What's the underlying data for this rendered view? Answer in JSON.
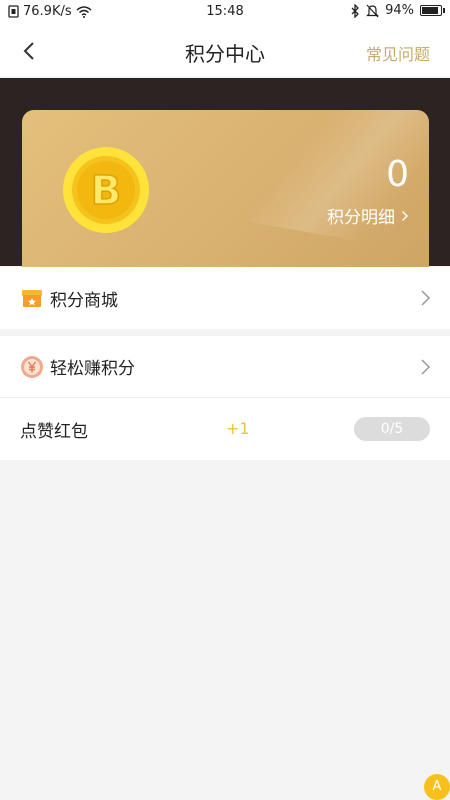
{
  "status_bar": {
    "net_speed": "76.9K/s",
    "time": "15:48",
    "battery": "94%",
    "battery_level": 0.94
  },
  "header": {
    "title": "积分中心",
    "faq_label": "常见问题"
  },
  "points_card": {
    "coin_letter": "B",
    "points": "0",
    "detail_label": "积分明细"
  },
  "menu": {
    "mall_label": "积分商城",
    "earn_label": "轻松赚积分"
  },
  "task": {
    "name": "点赞红包",
    "reward": "+1",
    "progress": "0/5",
    "done": 0,
    "total": 5
  },
  "floating": {
    "badge_label": "A"
  },
  "colors": {
    "accent_gold": "#c7a96c",
    "card_gold": "#d9b170",
    "hero_dark": "#2c2422",
    "reward_yellow": "#f1c040"
  }
}
